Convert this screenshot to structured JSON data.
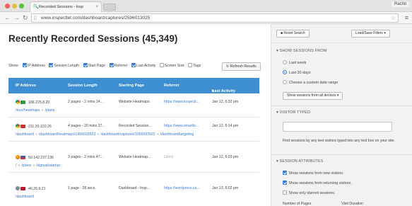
{
  "browser": {
    "tab_title": "Recorded Sessions - Insp",
    "url": "www.inspectlet.com/dashboard/captures/2596013025",
    "user": "Rachit"
  },
  "page": {
    "title": "Recently Recorded Sessions (45,349)",
    "show_label": "Show:",
    "column_toggles": [
      {
        "label": "IP Address",
        "checked": true
      },
      {
        "label": "Session Length",
        "checked": true
      },
      {
        "label": "Start Page",
        "checked": true
      },
      {
        "label": "Referrer",
        "checked": true
      },
      {
        "label": "Last Activity",
        "checked": true
      },
      {
        "label": "Screen Size",
        "checked": false
      },
      {
        "label": "Tags",
        "checked": false
      }
    ],
    "refresh_label": "Refresh Results"
  },
  "table": {
    "headers": [
      "IP Address",
      "Session Length",
      "Starting Page",
      "Referrer",
      "Last Activity"
    ],
    "sort_indicator": "▾",
    "rows": [
      {
        "ip": "186.225.8.20",
        "length": "2 pages - 2 mins 14...",
        "start": "Website Heatmaps",
        "referrer": "https://www.inspecti...",
        "last": "Jan 12, 6:32 pm",
        "paths": [
          "/tour/heatmaps",
          "/plans"
        ],
        "browser_icon": "chrome",
        "flag_color": "#2d9a3a"
      },
      {
        "ip": "211.20.120.26",
        "length": "4 pages - 20 mins 37...",
        "start": "Recorded Session...",
        "referrer": "https://www.smartlo...",
        "last": "Jan 12, 6:14 pm",
        "paths": [
          "/dashboard",
          "/dashboard/heatmaps/1956693922",
          "/dashboard/captures/1956693922",
          "/dashboard/targeting"
        ],
        "browser_icon": "chrome",
        "flag_color": "#d0312d"
      },
      {
        "ip": "50.142.237.136",
        "length": "3 pages - 2 mins 47...",
        "start": "Website Heatmap...",
        "referrer": "Direct",
        "last": "Jan 12, 6:03 pm",
        "paths": [
          "/",
          "/plans",
          "/signup/startup"
        ],
        "browser_icon": "firefox",
        "flag_color": "#3b5aa6"
      },
      {
        "ip": "46.26.9.21",
        "length": "1 page - 28 secs",
        "start": "Dashboard - Insp...",
        "referrer": "https://wordpress.co...",
        "last": "Jan 13, 6:02 pm",
        "paths": [
          "/dashboard"
        ],
        "browser_icon": "gray",
        "flag_color": "#c8102e"
      }
    ]
  },
  "sidebar": {
    "reset_label": "Reset Search",
    "load_save_label": "Load/Save Filters",
    "show_from_title": "SHOW SESSIONS FROM",
    "date_options": [
      {
        "label": "Last week",
        "selected": false
      },
      {
        "label": "Last 30 days",
        "selected": true
      },
      {
        "label": "Choose a custom date range",
        "selected": false
      }
    ],
    "device_select": "Show sessions from all devices",
    "visitor_title": "VISITOR TYPED",
    "visitor_help": "Find sessions by any text visitors typed into any text box on your site.",
    "attributes_title": "SESSION ATTRIBUTES",
    "attributes": [
      {
        "label": "Show sessions from new visitors.",
        "checked": true
      },
      {
        "label": "Show sessions from returning visitors.",
        "checked": true
      },
      {
        "label": "Show only starred sessions.",
        "checked": false
      }
    ],
    "number_of_pages_label": "Number of Pages",
    "visit_duration_label": "Visit Duration"
  }
}
